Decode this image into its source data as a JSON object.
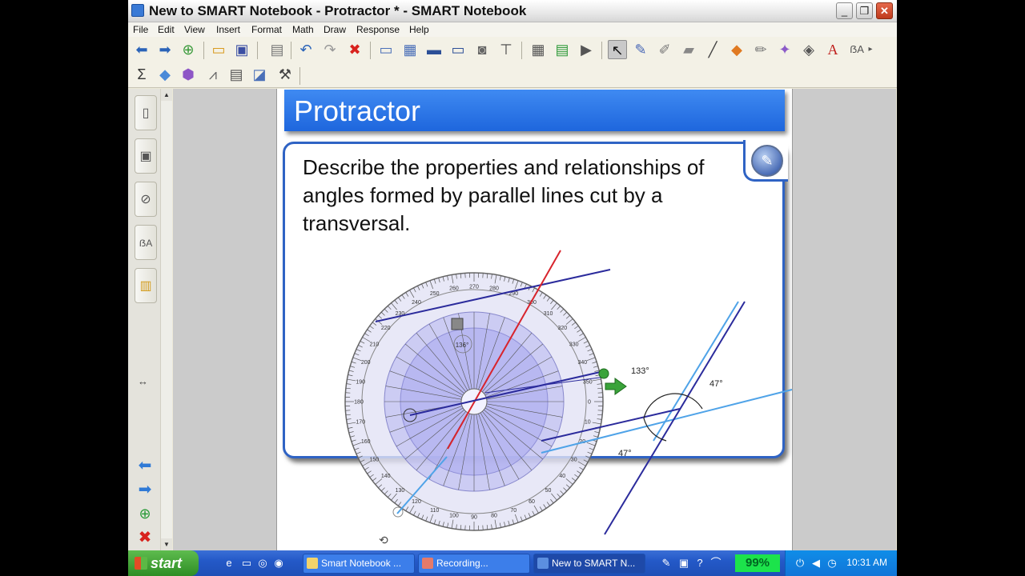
{
  "window": {
    "title": "New to SMART Notebook - Protractor * - SMART Notebook",
    "min": "_",
    "max": "❐",
    "close": "✕"
  },
  "menu": [
    "File",
    "Edit",
    "View",
    "Insert",
    "Format",
    "Math",
    "Draw",
    "Response",
    "Help"
  ],
  "page": {
    "banner_title": "Protractor",
    "question": "Describe the properties and relationships of angles formed by parallel lines cut by a transversal.",
    "angles": {
      "protractor_readout": "133°",
      "inner_readout": "136°",
      "upper_right": "47°",
      "lower_left": "47°"
    },
    "protractor_ticks_outer": [
      "180",
      "190",
      "200",
      "210",
      "220",
      "230",
      "240",
      "250",
      "260",
      "270",
      "280",
      "290",
      "300",
      "310",
      "320",
      "330",
      "340",
      "350",
      "0",
      "10",
      "20",
      "30",
      "40",
      "50",
      "60",
      "70",
      "80",
      "90",
      "100",
      "110",
      "120",
      "130",
      "140",
      "150",
      "160",
      "170"
    ]
  },
  "taskbar": {
    "start": "start",
    "tasks": [
      {
        "label": "Smart Notebook ..."
      },
      {
        "label": "Recording..."
      },
      {
        "label": "New to SMART N..."
      }
    ],
    "percent": "99%",
    "clock": "10:31 AM"
  },
  "colors": {
    "banner": "#2a73e6",
    "card_border": "#2f63c4",
    "taskbar": "#245dd0"
  }
}
